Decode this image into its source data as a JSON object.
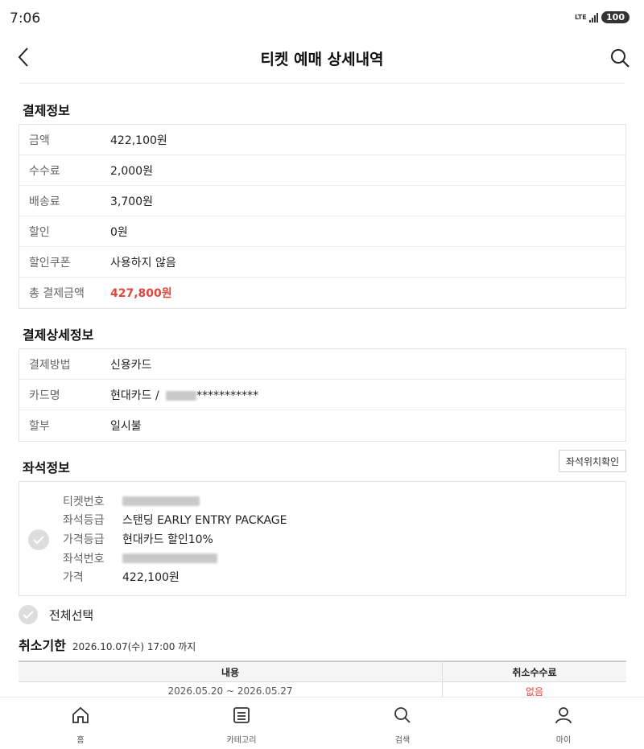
{
  "status_bar": {
    "time": "7:06",
    "network": "LTE",
    "battery": "100"
  },
  "header": {
    "title": "티켓 예매 상세내역",
    "back_icon": "chevron-left-icon",
    "search_icon": "search-icon"
  },
  "payment_info": {
    "title": "결제정보",
    "rows": [
      {
        "label": "금액",
        "value": "422,100원"
      },
      {
        "label": "수수료",
        "value": "2,000원"
      },
      {
        "label": "배송료",
        "value": "3,700원"
      },
      {
        "label": "할인",
        "value": "0원"
      },
      {
        "label": "할인쿠폰",
        "value": "사용하지 않음"
      },
      {
        "label": "총 결제금액",
        "value": "427,800원"
      }
    ],
    "total_color": "#e0473d"
  },
  "payment_detail": {
    "title": "결제상세정보",
    "rows": [
      {
        "label": "결제방법",
        "value": "신용카드"
      },
      {
        "label": "카드명",
        "value": "현대카드 /",
        "suffix": "***********"
      },
      {
        "label": "할부",
        "value": "일시불"
      }
    ]
  },
  "seat_info": {
    "title": "좌석정보",
    "location_button": "좌석위치확인",
    "rows": [
      {
        "label": "티켓번호",
        "value": ""
      },
      {
        "label": "좌석등급",
        "value": "스탠딩 EARLY ENTRY PACKAGE"
      },
      {
        "label": "가격등급",
        "value": "현대카드 할인10%"
      },
      {
        "label": "좌석번호",
        "value": ""
      },
      {
        "label": "가격",
        "value": "422,100원"
      }
    ]
  },
  "select_all": {
    "label": "전체선택"
  },
  "cancel_deadline": {
    "title": "취소기한",
    "value": "2026.10.07(수) 17:00 까지"
  },
  "fee_table": {
    "headers": [
      "내용",
      "취소수수료"
    ],
    "rows": [
      {
        "period": "2026.05.20 ~ 2026.05.27",
        "fee": "없음"
      }
    ]
  },
  "bottom_nav": [
    {
      "label": "홈",
      "icon": "home-icon"
    },
    {
      "label": "카테고리",
      "icon": "list-icon"
    },
    {
      "label": "검색",
      "icon": "search-icon"
    },
    {
      "label": "마이",
      "icon": "user-icon"
    }
  ]
}
